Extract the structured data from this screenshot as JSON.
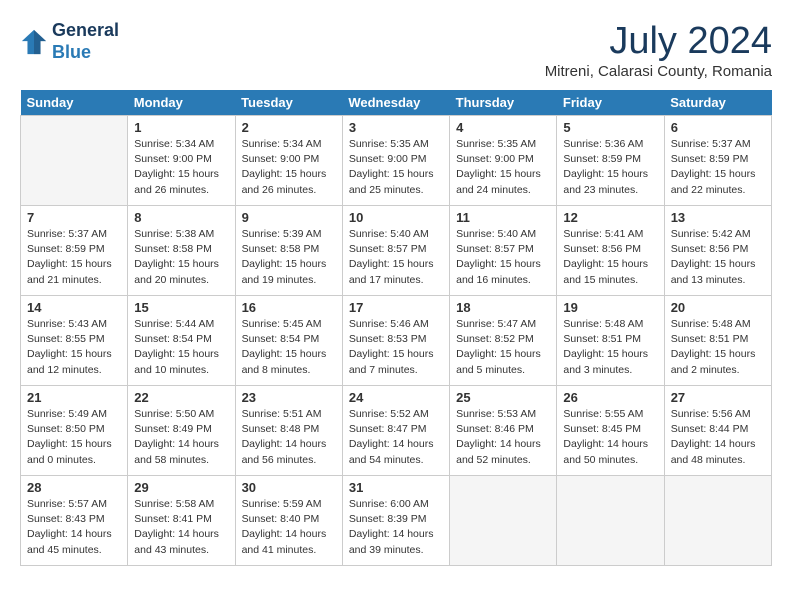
{
  "header": {
    "logo_general": "General",
    "logo_blue": "Blue",
    "month_year": "July 2024",
    "location": "Mitreni, Calarasi County, Romania"
  },
  "days_of_week": [
    "Sunday",
    "Monday",
    "Tuesday",
    "Wednesday",
    "Thursday",
    "Friday",
    "Saturday"
  ],
  "weeks": [
    [
      {
        "day": "",
        "sunrise": "",
        "sunset": "",
        "daylight": ""
      },
      {
        "day": "1",
        "sunrise": "Sunrise: 5:34 AM",
        "sunset": "Sunset: 9:00 PM",
        "daylight": "Daylight: 15 hours and 26 minutes."
      },
      {
        "day": "2",
        "sunrise": "Sunrise: 5:34 AM",
        "sunset": "Sunset: 9:00 PM",
        "daylight": "Daylight: 15 hours and 26 minutes."
      },
      {
        "day": "3",
        "sunrise": "Sunrise: 5:35 AM",
        "sunset": "Sunset: 9:00 PM",
        "daylight": "Daylight: 15 hours and 25 minutes."
      },
      {
        "day": "4",
        "sunrise": "Sunrise: 5:35 AM",
        "sunset": "Sunset: 9:00 PM",
        "daylight": "Daylight: 15 hours and 24 minutes."
      },
      {
        "day": "5",
        "sunrise": "Sunrise: 5:36 AM",
        "sunset": "Sunset: 8:59 PM",
        "daylight": "Daylight: 15 hours and 23 minutes."
      },
      {
        "day": "6",
        "sunrise": "Sunrise: 5:37 AM",
        "sunset": "Sunset: 8:59 PM",
        "daylight": "Daylight: 15 hours and 22 minutes."
      }
    ],
    [
      {
        "day": "7",
        "sunrise": "Sunrise: 5:37 AM",
        "sunset": "Sunset: 8:59 PM",
        "daylight": "Daylight: 15 hours and 21 minutes."
      },
      {
        "day": "8",
        "sunrise": "Sunrise: 5:38 AM",
        "sunset": "Sunset: 8:58 PM",
        "daylight": "Daylight: 15 hours and 20 minutes."
      },
      {
        "day": "9",
        "sunrise": "Sunrise: 5:39 AM",
        "sunset": "Sunset: 8:58 PM",
        "daylight": "Daylight: 15 hours and 19 minutes."
      },
      {
        "day": "10",
        "sunrise": "Sunrise: 5:40 AM",
        "sunset": "Sunset: 8:57 PM",
        "daylight": "Daylight: 15 hours and 17 minutes."
      },
      {
        "day": "11",
        "sunrise": "Sunrise: 5:40 AM",
        "sunset": "Sunset: 8:57 PM",
        "daylight": "Daylight: 15 hours and 16 minutes."
      },
      {
        "day": "12",
        "sunrise": "Sunrise: 5:41 AM",
        "sunset": "Sunset: 8:56 PM",
        "daylight": "Daylight: 15 hours and 15 minutes."
      },
      {
        "day": "13",
        "sunrise": "Sunrise: 5:42 AM",
        "sunset": "Sunset: 8:56 PM",
        "daylight": "Daylight: 15 hours and 13 minutes."
      }
    ],
    [
      {
        "day": "14",
        "sunrise": "Sunrise: 5:43 AM",
        "sunset": "Sunset: 8:55 PM",
        "daylight": "Daylight: 15 hours and 12 minutes."
      },
      {
        "day": "15",
        "sunrise": "Sunrise: 5:44 AM",
        "sunset": "Sunset: 8:54 PM",
        "daylight": "Daylight: 15 hours and 10 minutes."
      },
      {
        "day": "16",
        "sunrise": "Sunrise: 5:45 AM",
        "sunset": "Sunset: 8:54 PM",
        "daylight": "Daylight: 15 hours and 8 minutes."
      },
      {
        "day": "17",
        "sunrise": "Sunrise: 5:46 AM",
        "sunset": "Sunset: 8:53 PM",
        "daylight": "Daylight: 15 hours and 7 minutes."
      },
      {
        "day": "18",
        "sunrise": "Sunrise: 5:47 AM",
        "sunset": "Sunset: 8:52 PM",
        "daylight": "Daylight: 15 hours and 5 minutes."
      },
      {
        "day": "19",
        "sunrise": "Sunrise: 5:48 AM",
        "sunset": "Sunset: 8:51 PM",
        "daylight": "Daylight: 15 hours and 3 minutes."
      },
      {
        "day": "20",
        "sunrise": "Sunrise: 5:48 AM",
        "sunset": "Sunset: 8:51 PM",
        "daylight": "Daylight: 15 hours and 2 minutes."
      }
    ],
    [
      {
        "day": "21",
        "sunrise": "Sunrise: 5:49 AM",
        "sunset": "Sunset: 8:50 PM",
        "daylight": "Daylight: 15 hours and 0 minutes."
      },
      {
        "day": "22",
        "sunrise": "Sunrise: 5:50 AM",
        "sunset": "Sunset: 8:49 PM",
        "daylight": "Daylight: 14 hours and 58 minutes."
      },
      {
        "day": "23",
        "sunrise": "Sunrise: 5:51 AM",
        "sunset": "Sunset: 8:48 PM",
        "daylight": "Daylight: 14 hours and 56 minutes."
      },
      {
        "day": "24",
        "sunrise": "Sunrise: 5:52 AM",
        "sunset": "Sunset: 8:47 PM",
        "daylight": "Daylight: 14 hours and 54 minutes."
      },
      {
        "day": "25",
        "sunrise": "Sunrise: 5:53 AM",
        "sunset": "Sunset: 8:46 PM",
        "daylight": "Daylight: 14 hours and 52 minutes."
      },
      {
        "day": "26",
        "sunrise": "Sunrise: 5:55 AM",
        "sunset": "Sunset: 8:45 PM",
        "daylight": "Daylight: 14 hours and 50 minutes."
      },
      {
        "day": "27",
        "sunrise": "Sunrise: 5:56 AM",
        "sunset": "Sunset: 8:44 PM",
        "daylight": "Daylight: 14 hours and 48 minutes."
      }
    ],
    [
      {
        "day": "28",
        "sunrise": "Sunrise: 5:57 AM",
        "sunset": "Sunset: 8:43 PM",
        "daylight": "Daylight: 14 hours and 45 minutes."
      },
      {
        "day": "29",
        "sunrise": "Sunrise: 5:58 AM",
        "sunset": "Sunset: 8:41 PM",
        "daylight": "Daylight: 14 hours and 43 minutes."
      },
      {
        "day": "30",
        "sunrise": "Sunrise: 5:59 AM",
        "sunset": "Sunset: 8:40 PM",
        "daylight": "Daylight: 14 hours and 41 minutes."
      },
      {
        "day": "31",
        "sunrise": "Sunrise: 6:00 AM",
        "sunset": "Sunset: 8:39 PM",
        "daylight": "Daylight: 14 hours and 39 minutes."
      },
      {
        "day": "",
        "sunrise": "",
        "sunset": "",
        "daylight": ""
      },
      {
        "day": "",
        "sunrise": "",
        "sunset": "",
        "daylight": ""
      },
      {
        "day": "",
        "sunrise": "",
        "sunset": "",
        "daylight": ""
      }
    ]
  ]
}
